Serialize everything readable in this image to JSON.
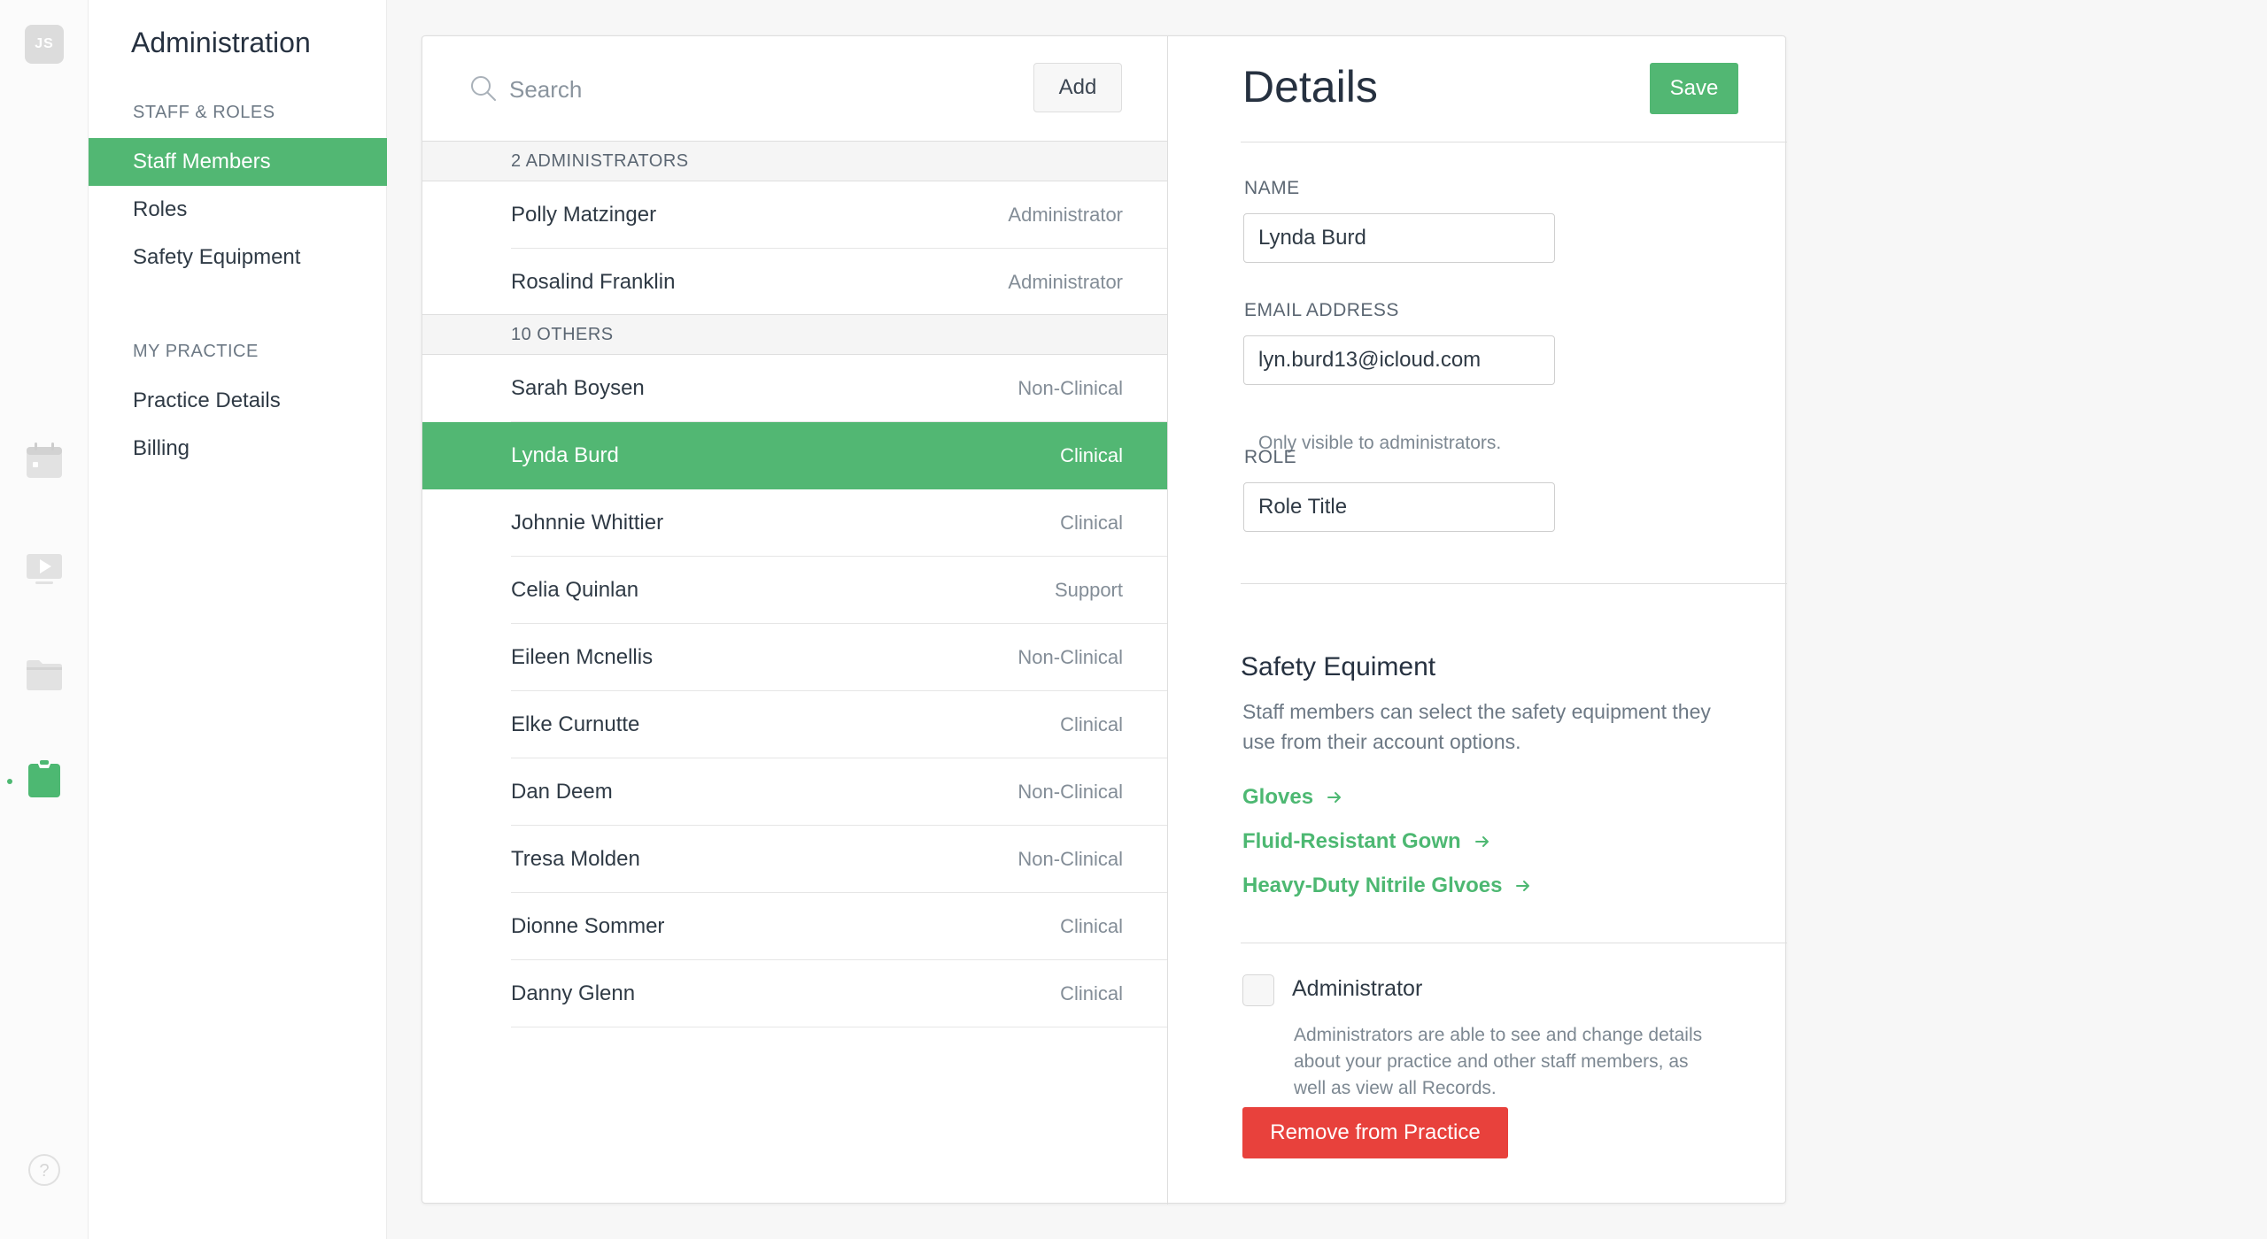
{
  "rail": {
    "avatar_initials": "JS",
    "icons": [
      "calendar-icon",
      "video-icon",
      "folder-icon",
      "clipboard-icon",
      "help-icon"
    ]
  },
  "sidebar": {
    "title": "Administration",
    "sections": [
      {
        "label": "STAFF & ROLES",
        "items": [
          {
            "label": "Staff Members",
            "active": true
          },
          {
            "label": "Roles"
          },
          {
            "label": "Safety Equipment"
          }
        ]
      },
      {
        "label": "MY PRACTICE",
        "items": [
          {
            "label": "Practice Details"
          },
          {
            "label": "Billing"
          }
        ]
      }
    ]
  },
  "list": {
    "search_placeholder": "Search",
    "add_label": "Add",
    "groups": [
      {
        "label": "2 ADMINISTRATORS",
        "members": [
          {
            "name": "Polly Matzinger",
            "role": "Administrator"
          },
          {
            "name": "Rosalind Franklin",
            "role": "Administrator"
          }
        ]
      },
      {
        "label": "10 OTHERS",
        "members": [
          {
            "name": "Sarah Boysen",
            "role": "Non-Clinical"
          },
          {
            "name": "Lynda Burd",
            "role": "Clinical",
            "selected": true
          },
          {
            "name": "Johnnie Whittier",
            "role": "Clinical"
          },
          {
            "name": "Celia Quinlan",
            "role": "Support"
          },
          {
            "name": "Eileen Mcnellis",
            "role": "Non-Clinical"
          },
          {
            "name": "Elke Curnutte",
            "role": "Clinical"
          },
          {
            "name": "Dan Deem",
            "role": "Non-Clinical"
          },
          {
            "name": "Tresa Molden",
            "role": "Non-Clinical"
          },
          {
            "name": "Dionne Sommer",
            "role": "Clinical"
          },
          {
            "name": "Danny Glenn",
            "role": "Clinical"
          }
        ]
      }
    ]
  },
  "details": {
    "title": "Details",
    "save_label": "Save",
    "name_label": "NAME",
    "name_value": "Lynda Burd",
    "email_label": "EMAIL ADDRESS",
    "email_value": "lyn.burd13@icloud.com",
    "email_help": "Only visible to administrators.",
    "role_label": "ROLE",
    "role_value": "Role Title",
    "safety": {
      "heading": "Safety Equiment",
      "description": "Staff members can select the safety equipment they use from their account options.",
      "items": [
        "Gloves",
        "Fluid-Resistant Gown",
        "Heavy-Duty Nitrile Glvoes"
      ]
    },
    "admin_checkbox_label": "Administrator",
    "admin_checked": false,
    "admin_description": "Administrators are able to see and change details about your practice and other staff members, as well as view all Records.",
    "remove_label": "Remove from Practice"
  },
  "colors": {
    "accent": "#52b773",
    "danger": "#e8413c"
  }
}
